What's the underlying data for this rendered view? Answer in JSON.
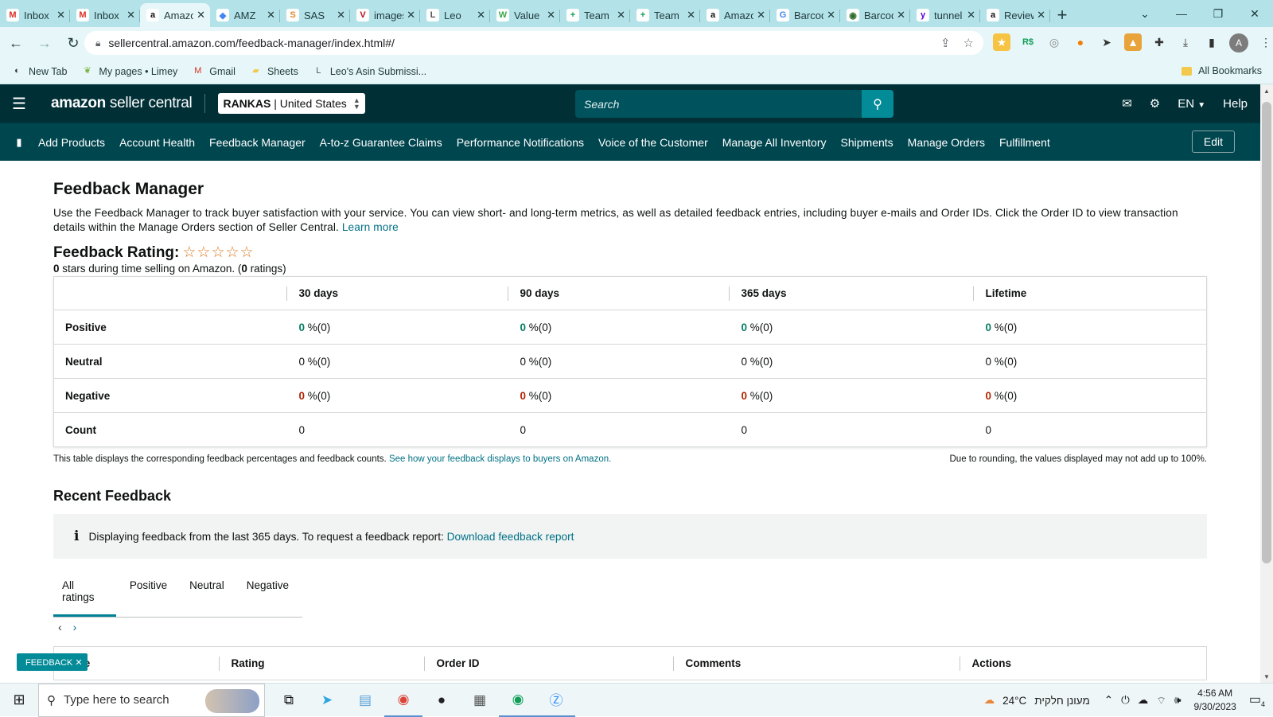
{
  "browser": {
    "tabs": [
      {
        "title": "Inbox",
        "icon": "gmail-icon",
        "glyph": "M",
        "color": "#d93025"
      },
      {
        "title": "Inbox",
        "icon": "gmail-icon",
        "glyph": "M",
        "color": "#d93025"
      },
      {
        "title": "Amazon",
        "icon": "amazon-icon",
        "glyph": "a",
        "color": "#111111",
        "active": true
      },
      {
        "title": "AMZ",
        "icon": "multicolor-icon",
        "glyph": "◆",
        "color": "#4285f4"
      },
      {
        "title": "SAS",
        "icon": "sas-icon",
        "glyph": "S",
        "color": "#e38a2b"
      },
      {
        "title": "images",
        "icon": "vivino-icon",
        "glyph": "V",
        "color": "#b5121b"
      },
      {
        "title": "Leo",
        "icon": "leo-icon",
        "glyph": "L",
        "color": "#555555"
      },
      {
        "title": "Value",
        "icon": "w-icon",
        "glyph": "W",
        "color": "#3aa845"
      },
      {
        "title": "Team",
        "icon": "sheets-plus-icon",
        "glyph": "+",
        "color": "#0f9d58"
      },
      {
        "title": "Team",
        "icon": "sheets-plus-icon",
        "glyph": "+",
        "color": "#0f9d58"
      },
      {
        "title": "Amazon",
        "icon": "amazon-icon",
        "glyph": "a",
        "color": "#111111"
      },
      {
        "title": "Barcode",
        "icon": "google-icon",
        "glyph": "G",
        "color": "#4285f4"
      },
      {
        "title": "Barcode",
        "icon": "barcode-icon",
        "glyph": "◉",
        "color": "#2f6d2a"
      },
      {
        "title": "tunnel",
        "icon": "yahoo-icon",
        "glyph": "y",
        "color": "#6001d2"
      },
      {
        "title": "Reviews",
        "icon": "amazon-icon",
        "glyph": "a",
        "color": "#111111"
      }
    ],
    "url": "sellercentral.amazon.com/feedback-manager/index.html#/",
    "bookmarks": [
      {
        "label": "New Tab",
        "icon": "new-tab-icon",
        "glyph": "◐",
        "color": "#333333"
      },
      {
        "label": "My pages • Limey",
        "icon": "limey-icon",
        "glyph": "❦",
        "color": "#7cb342"
      },
      {
        "label": "Gmail",
        "icon": "gmail-icon",
        "glyph": "M",
        "color": "#d93025"
      },
      {
        "label": "Sheets",
        "icon": "folder-icon",
        "glyph": "▰",
        "color": "#f2c94c"
      },
      {
        "label": "Leo's Asin Submissi...",
        "icon": "leo-icon",
        "glyph": "L",
        "color": "#555555"
      }
    ],
    "all_bookmarks": "All Bookmarks",
    "profile_initial": "A"
  },
  "header": {
    "logo_bold": "amazon",
    "logo_rest": " seller central",
    "store": "RANKAS",
    "marketplace": "| United States",
    "search_placeholder": "Search",
    "language": "EN",
    "help": "Help"
  },
  "nav": {
    "items": [
      "Add Products",
      "Account Health",
      "Feedback Manager",
      "A-to-z Guarantee Claims",
      "Performance Notifications",
      "Voice of the Customer",
      "Manage All Inventory",
      "Shipments",
      "Manage Orders",
      "Fulfillment"
    ],
    "edit": "Edit"
  },
  "page": {
    "title": "Feedback Manager",
    "intro": "Use the Feedback Manager to track buyer satisfaction with your service. You can view short- and long-term metrics, as well as detailed feedback entries, including buyer e-mails and Order IDs. Click the Order ID to view transaction details within the Manage Orders section of Seller Central.",
    "learn_more": "Learn more",
    "rating_label": "Feedback Rating:",
    "stars_glyph": "☆☆☆☆☆",
    "rating_value": 0,
    "stars_count": "0",
    "stars_text": " stars during time selling on Amazon. (",
    "ratings_count": "0",
    "ratings_text": " ratings)"
  },
  "metrics": {
    "columns": [
      "30 days",
      "90 days",
      "365 days",
      "Lifetime"
    ],
    "rows": [
      {
        "label": "Positive",
        "tone": "g",
        "cells": [
          [
            "0",
            " %(0)"
          ],
          [
            "0",
            " %(0)"
          ],
          [
            "0",
            " %(0)"
          ],
          [
            "0",
            " %(0)"
          ]
        ]
      },
      {
        "label": "Neutral",
        "tone": "n",
        "cells": [
          [
            "0",
            " %(0)"
          ],
          [
            "0",
            " %(0)"
          ],
          [
            "0",
            " %(0)"
          ],
          [
            "0",
            " %(0)"
          ]
        ]
      },
      {
        "label": "Negative",
        "tone": "r",
        "cells": [
          [
            "0",
            " %(0)"
          ],
          [
            "0",
            " %(0)"
          ],
          [
            "0",
            " %(0)"
          ],
          [
            "0",
            " %(0)"
          ]
        ]
      },
      {
        "label": "Count",
        "tone": "c",
        "cells": [
          [
            "0",
            ""
          ],
          [
            "0",
            ""
          ],
          [
            "0",
            ""
          ],
          [
            "0",
            ""
          ]
        ]
      }
    ],
    "note_left": "This table displays the corresponding feedback percentages and feedback counts.",
    "note_link": "See how your feedback displays to buyers on Amazon.",
    "note_right": "Due to rounding, the values displayed may not add up to 100%."
  },
  "recent": {
    "title": "Recent Feedback",
    "info_text": "Displaying feedback from the last 365 days. To request a feedback report:",
    "info_link": "Download feedback report",
    "tabs": [
      "All ratings",
      "Positive",
      "Neutral",
      "Negative"
    ],
    "active_tab": 0,
    "table_headers": [
      "Date",
      "Rating",
      "Order ID",
      "Comments",
      "Actions"
    ]
  },
  "feedback_badge": "FEEDBACK ✕",
  "taskbar": {
    "search_placeholder": "Type here to search",
    "weather_temp": "24°C",
    "weather_text": "מעונן חלקית",
    "time": "4:56 AM",
    "date": "9/30/2023",
    "notification_count": "4"
  }
}
